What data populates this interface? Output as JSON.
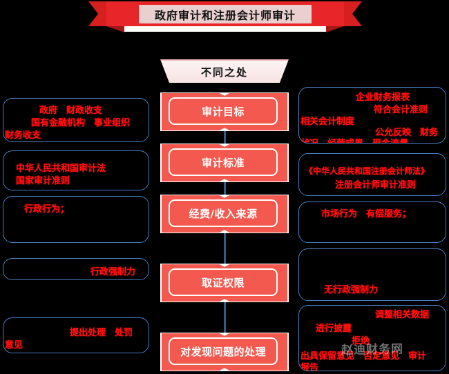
{
  "header": {
    "banner_title": "政府审计和注册会计师审计",
    "subtitle": "不同之处",
    "banner_color": "#e8262a",
    "banner_inner_color": "#e9cfcf"
  },
  "center_nodes": [
    {
      "label": "审计目标"
    },
    {
      "label": "审计标准"
    },
    {
      "label": "经费/收入来源"
    },
    {
      "label": "取证权限"
    },
    {
      "label": "对发现问题的处理"
    }
  ],
  "left_panels": [
    {
      "lines": [
        "政府　财政收支",
        "国有金融机构　事业组织",
        "财务收支"
      ]
    },
    {
      "lines": [
        "中华人民共和国审计法",
        "国家审计准则"
      ]
    },
    {
      "lines": [
        "行政行为；"
      ]
    },
    {
      "lines": [
        "行政强制力"
      ]
    },
    {
      "lines": [
        "提出处理　处罚",
        "意见"
      ]
    }
  ],
  "right_panels": [
    {
      "lines": [
        "企业财务报表",
        "符合会计准则",
        "相关会计制度",
        "公允反映　财务",
        "状况　经营成果　现金流量"
      ]
    },
    {
      "lines": [
        "《中华人民共和国注册会计师法》",
        "注册会计师审计准则"
      ]
    },
    {
      "lines": [
        "市场行为　有偿服务；"
      ]
    },
    {
      "lines": [
        "无行政强制力"
      ]
    },
    {
      "lines": [
        "调整相关数据",
        "进行披露",
        "拒绝",
        "出具保留意见　否定意见　审计",
        "报告"
      ]
    }
  ],
  "watermark": {
    "text": "赵迪财务网"
  },
  "colors": {
    "background": "#000000",
    "panel_border": "#4a7fc1",
    "panel_text": "#ff1010",
    "node_fill": "#f4594f",
    "connector": "#2f5d8c"
  }
}
